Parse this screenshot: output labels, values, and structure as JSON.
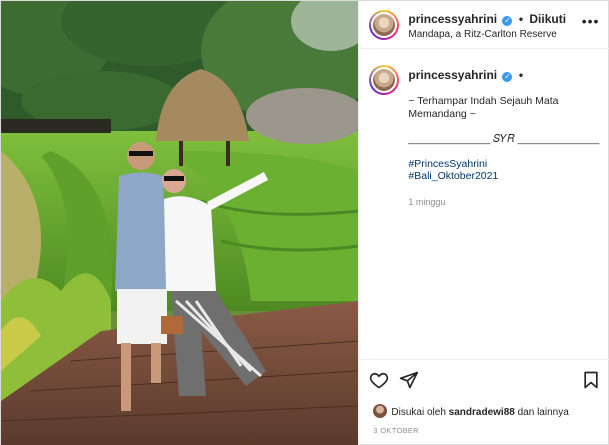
{
  "post": {
    "username": "princessyahrini",
    "follow_status": "Diikuti",
    "location": "Mandapa, a Ritz-Carlton Reserve",
    "more_icon": "ellipsis-icon",
    "verified_icon": "verified-badge-icon",
    "caption": {
      "username": "princessyahrini",
      "lines": [
        "~ Terhampar Indah Sejauh Mata",
        "Memandang ~",
        "",
        "______________ 𝑆𝑌𝑅 ______________",
        "",
        "#PrincesSyahrini",
        "#Bali_Oktober2021"
      ],
      "time_ago": "1 minggu"
    },
    "actions": {
      "like_icon": "heart-icon",
      "share_icon": "paper-plane-icon",
      "save_icon": "bookmark-icon"
    },
    "likes_text_prefix": "Disukai oleh ",
    "likes_user": "sandradewi88",
    "likes_text_suffix": " dan lainnya",
    "date": "3 OKTOBER"
  }
}
